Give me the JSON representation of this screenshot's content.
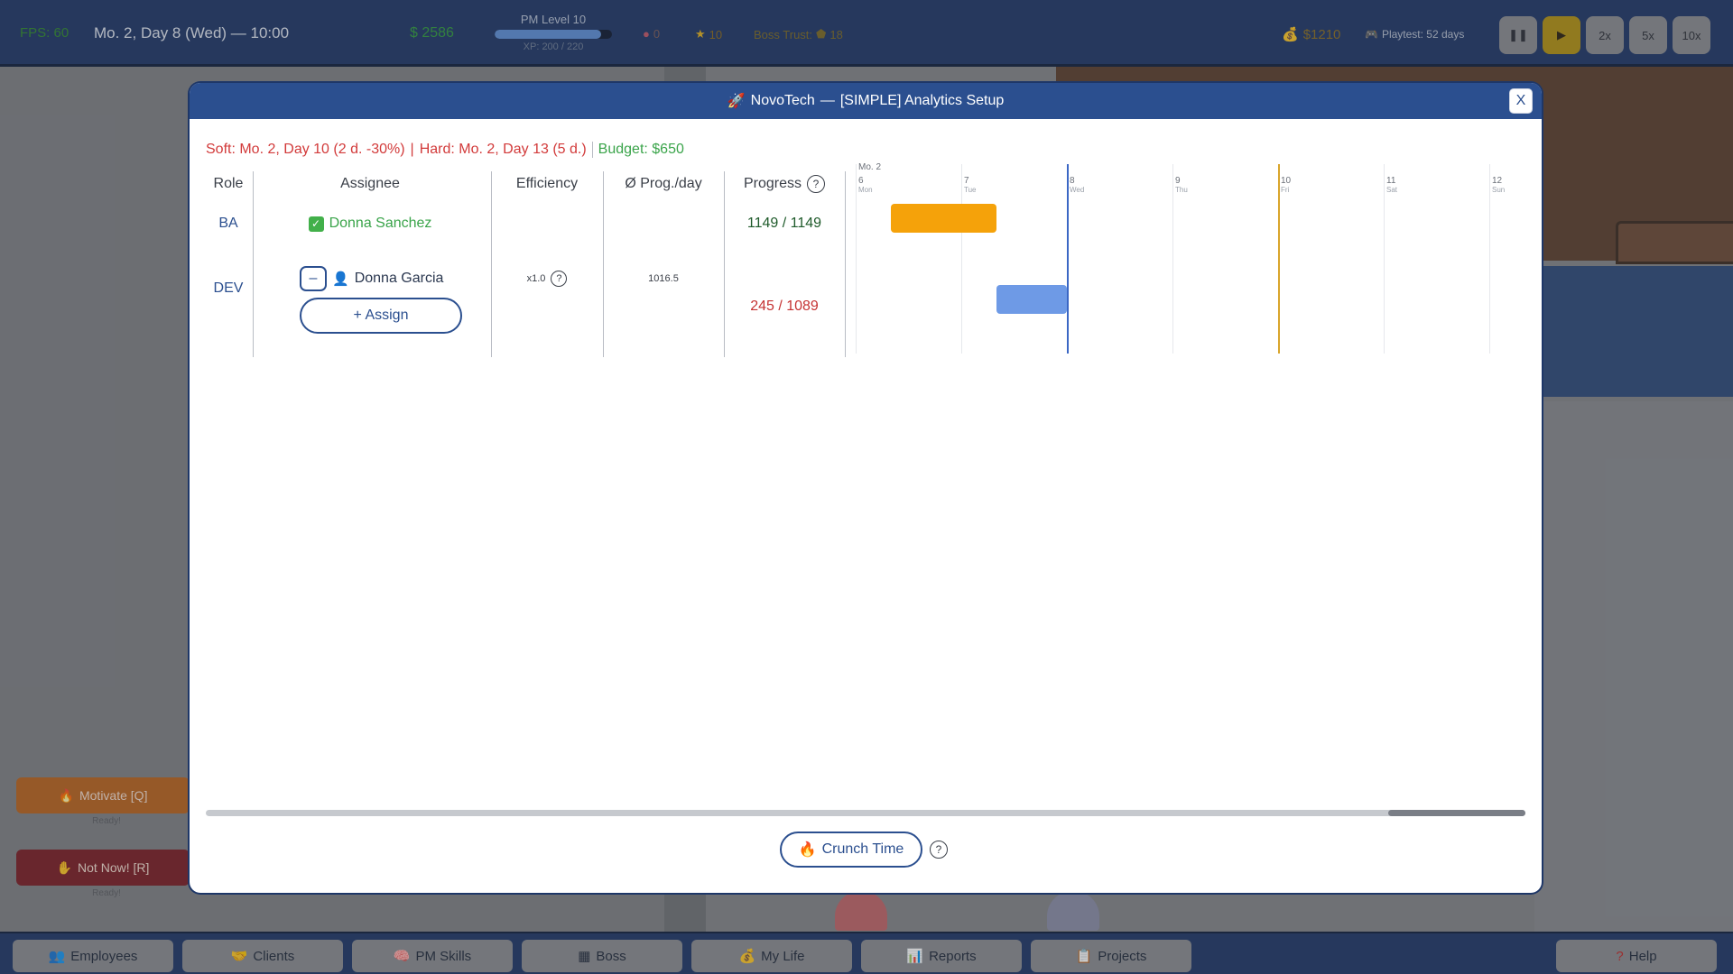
{
  "hud": {
    "fps": "FPS: 60",
    "date": "Mo. 2, Day 8 (Wed) — 10:00",
    "cash": "$ 2586",
    "pm_level": "PM Level 10",
    "xp_text": "XP: 200 / 220",
    "xp_fraction": 0.91,
    "brain": "0",
    "stars": "10",
    "boss_trust_label": "Boss Trust:",
    "boss_trust_value": "18",
    "money": "$1210",
    "playtest": "Playtest: 52 days",
    "speed_buttons": [
      "2x",
      "5x",
      "10x"
    ]
  },
  "side": {
    "motivate": "Motivate [Q]",
    "motivate_status": "Ready!",
    "notnow": "Not Now! [R]",
    "notnow_status": "Ready!"
  },
  "nav": [
    "Employees",
    "Clients",
    "PM Skills",
    "Boss",
    "My Life",
    "Reports",
    "Projects"
  ],
  "help": "Help",
  "modal": {
    "title_company": "NovoTech",
    "title_dash": "—",
    "title_project": "[SIMPLE] Analytics Setup",
    "close": "X",
    "soft": "Soft: Mo. 2, Day 10 (2 d. -30%)",
    "sep": "|",
    "hard": "Hard: Mo. 2, Day 13 (5 d.)",
    "budget": "Budget: $650",
    "columns": {
      "role": "Role",
      "assignee": "Assignee",
      "efficiency": "Efficiency",
      "prog_day": "Ø Prog./day",
      "progress": "Progress"
    },
    "rows": [
      {
        "role": "BA",
        "assignee": "Donna Sanchez",
        "progress": "1149 / 1149"
      },
      {
        "role": "DEV",
        "assignee": "Donna Garcia",
        "efficiency": "x1.0",
        "prog_day": "1016.5",
        "progress": "245 / 1089",
        "remove": "–",
        "assign": "+ Assign"
      }
    ],
    "gantt": {
      "month": "Mo. 2",
      "days": [
        {
          "d": "6",
          "w": "Mon"
        },
        {
          "d": "7",
          "w": "Tue"
        },
        {
          "d": "8",
          "w": "Wed"
        },
        {
          "d": "9",
          "w": "Thu"
        },
        {
          "d": "10",
          "w": "Fri"
        },
        {
          "d": "11",
          "w": "Sat"
        },
        {
          "d": "12",
          "w": "Sun"
        }
      ],
      "today_day": 8,
      "soft_deadline_day": 10,
      "ba_bar": {
        "start": 6.33,
        "end": 7.33
      },
      "dev_bar": {
        "start": 7.33,
        "end": 8.0
      }
    },
    "crunch": "Crunch Time",
    "help_mark": "?"
  },
  "colors": {
    "hud": "#1e3768",
    "header": "#2b4f8f",
    "ba_bar": "#f5a20a",
    "dev_bar": "#6e9ae6",
    "today": "#3b67c4",
    "soft_line": "#d9a52b"
  }
}
